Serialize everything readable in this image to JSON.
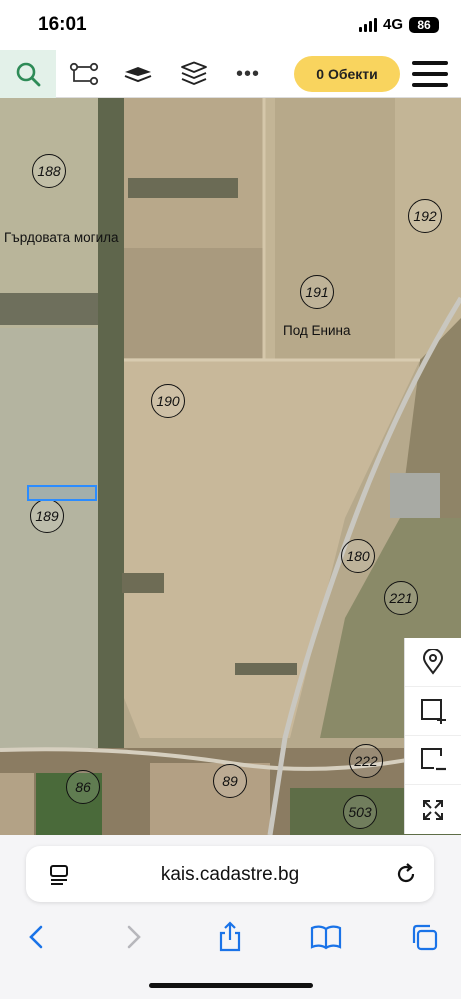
{
  "status_bar": {
    "time": "16:01",
    "network": "4G",
    "battery": "86"
  },
  "toolbar": {
    "search_icon": "search-icon",
    "route_icon": "route-icon",
    "layers_filled_icon": "layers-filled-icon",
    "layers_outline_icon": "layers-outline-icon",
    "more_label": "•••",
    "objects_label": "0 Обекти",
    "menu_icon": "hamburger-menu-icon",
    "accent_color": "#f9d45e",
    "search_bg": "#e3f1e9",
    "search_color": "#2e8b57"
  },
  "map": {
    "parcels": [
      {
        "id": "188",
        "label": "188"
      },
      {
        "id": "192",
        "label": "192"
      },
      {
        "id": "191",
        "label": "191"
      },
      {
        "id": "190",
        "label": "190"
      },
      {
        "id": "189",
        "label": "189"
      },
      {
        "id": "180",
        "label": "180"
      },
      {
        "id": "221",
        "label": "221"
      },
      {
        "id": "222",
        "label": "222"
      },
      {
        "id": "86",
        "label": "86"
      },
      {
        "id": "89",
        "label": "89"
      },
      {
        "id": "503",
        "label": "503"
      }
    ],
    "places": {
      "gardovata": "Гърдовата могила",
      "pod_enina": "Под Енина"
    },
    "selection_color": "#2b8cff",
    "controls": [
      "location-pin-icon",
      "zoom-select-add-icon",
      "zoom-select-remove-icon",
      "fullscreen-icon"
    ]
  },
  "browser": {
    "url": "kais.cadastre.bg",
    "reader_icon": "page-menu-icon",
    "reload_icon": "reload-icon",
    "nav": [
      "back-icon",
      "forward-icon",
      "share-icon",
      "bookmarks-icon",
      "tabs-icon"
    ],
    "link_color": "#1a73e8"
  }
}
